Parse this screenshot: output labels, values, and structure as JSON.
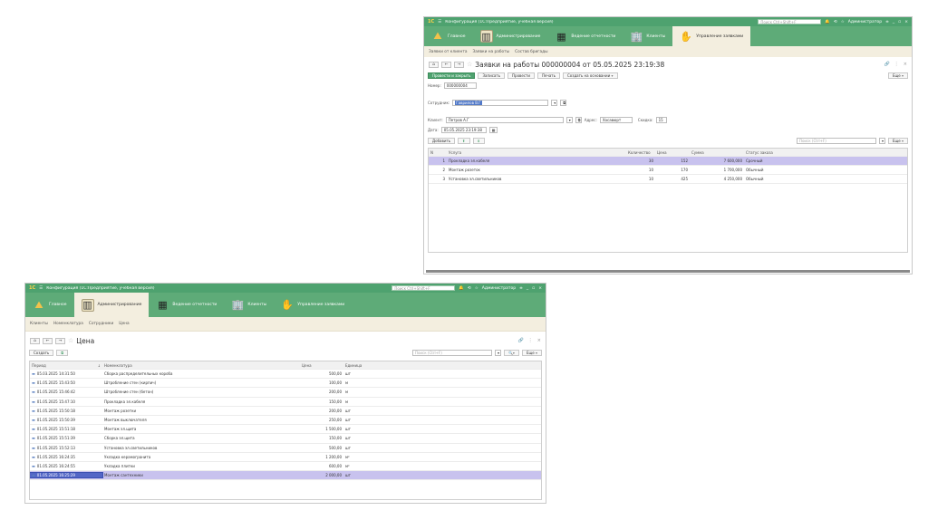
{
  "w1": {
    "title": "Конфигурация (1С:Предприятие, учебная версия)",
    "search_placeholder": "Поиск Ctrl+Shift+F",
    "user": "Администратор",
    "sections": [
      "Главное",
      "Администрирование",
      "Ведение отчетности",
      "Клиенты",
      "Управление заявками"
    ],
    "subnav": [
      "Заявки от клиента",
      "Заявки на работы",
      "Состав бригады"
    ],
    "doc_title": "Заявки на работы 000000004 от 05.05.2025 23:19:38",
    "buttons": {
      "post_close": "Провести и закрыть",
      "write": "Записать",
      "post": "Провести",
      "print": "Печать",
      "create_based": "Создать на основании"
    },
    "more": "Еще",
    "number_label": "Номер:",
    "number_value": "000000004",
    "employee_label": "Сотрудник:",
    "employee_value": "Гаврилов В.Г",
    "client_label": "Клиент:",
    "client_value": "Петров А.Г",
    "address_label": "Адрес:",
    "address_value": "Хасавюрт",
    "discount_label": "Скидка:",
    "discount_value": "15",
    "date_label": "Дата:",
    "date_value": "05.05.2025 23:19:38",
    "add_button": "Добавить",
    "table_search_placeholder": "Поиск (Ctrl+F)",
    "columns": [
      "N",
      "Услуга",
      "Количество",
      "Цена",
      "Сумма",
      "Статус заказа"
    ],
    "rows": [
      {
        "n": "1",
        "service": "Прокладка эл.кабеля",
        "qty": "30",
        "price": "152",
        "sum": "7 600,000",
        "status": "Срочный"
      },
      {
        "n": "2",
        "service": "Монтаж розеток",
        "qty": "10",
        "price": "170",
        "sum": "1 700,000",
        "status": "Обычный"
      },
      {
        "n": "3",
        "service": "Установка эл.светильников",
        "qty": "10",
        "price": "425",
        "sum": "4 250,000",
        "status": "Обычный"
      }
    ]
  },
  "w2": {
    "title": "Конфигурация (1С:Предприятие, учебная версия)",
    "search_placeholder": "Поиск Ctrl+Shift+F",
    "user": "Администратор",
    "sections": [
      "Главное",
      "Администрирование",
      "Ведение отчетности",
      "Клиенты",
      "Управление заявками"
    ],
    "subnav": [
      "Клиенты",
      "Номенклатура",
      "Сотрудники",
      "Цена"
    ],
    "page_title": "Цена",
    "create_button": "Создать",
    "search_placeholder2": "Поиск (Ctrl+F)",
    "more": "Еще",
    "columns": [
      "Период",
      "Номенклатура",
      "Цена",
      "Единица"
    ],
    "rows": [
      {
        "period": "05.03.2025 14:31:50",
        "item": "Сборка распределительных короба",
        "price": "500,00",
        "unit": "шт"
      },
      {
        "period": "01.05.2025 15:43:50",
        "item": "Штробление стен (кирпич)",
        "price": "100,00",
        "unit": "м"
      },
      {
        "period": "01.05.2025 15:46:42",
        "item": "Штробление стен (бетон)",
        "price": "200,00",
        "unit": "м"
      },
      {
        "period": "01.05.2025 15:47:10",
        "item": "Прокладка эл.кабеля",
        "price": "150,00",
        "unit": "м"
      },
      {
        "period": "01.05.2025 15:50:18",
        "item": "Монтаж розетки",
        "price": "200,00",
        "unit": "шт"
      },
      {
        "period": "01.05.2025 15:50:39",
        "item": "Монтаж выключателя",
        "price": "250,00",
        "unit": "шт"
      },
      {
        "period": "01.05.2025 15:51:18",
        "item": "Монтаж эл.щита",
        "price": "1 500,00",
        "unit": "шт"
      },
      {
        "period": "01.05.2025 15:51:39",
        "item": "Сборка эл.щита",
        "price": "150,00",
        "unit": "шт"
      },
      {
        "period": "01.05.2025 15:52:13",
        "item": "Установка эл.светильников",
        "price": "500,00",
        "unit": "шт"
      },
      {
        "period": "01.05.2025 16:24:35",
        "item": "Укладка керамогранита",
        "price": "1 200,00",
        "unit": "м²"
      },
      {
        "period": "01.05.2025 16:24:55",
        "item": "Укладка плитки",
        "price": "600,00",
        "unit": "м²"
      },
      {
        "period": "01.05.2025 16:25:29",
        "item": "Монтаж сантехники",
        "price": "2 000,00",
        "unit": "шт"
      }
    ]
  }
}
